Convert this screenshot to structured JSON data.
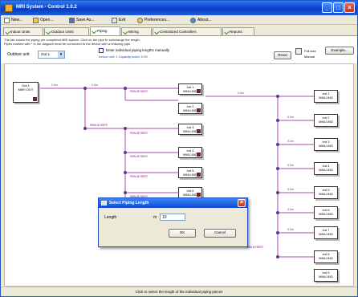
{
  "window": {
    "title": "MRI System - Control 1.0.2"
  },
  "menubar": {
    "items": [
      {
        "label": "New...",
        "icon": "new-file-icon"
      },
      {
        "label": "Open...",
        "icon": "open-folder-icon"
      },
      {
        "label": "Save As...",
        "icon": "save-icon"
      },
      {
        "label": "Exit",
        "icon": "exit-icon"
      },
      {
        "label": "Preferences...",
        "icon": "star-icon"
      },
      {
        "label": "About...",
        "icon": "info-icon"
      }
    ]
  },
  "tabs": [
    {
      "label": "Indoor Units",
      "active": false
    },
    {
      "label": "Outdoor Units",
      "active": false
    },
    {
      "label": "Piping",
      "active": true
    },
    {
      "label": "Wiring",
      "active": false
    },
    {
      "label": "Centralized Controllers",
      "active": false
    },
    {
      "label": "Reports",
      "active": false
    }
  ],
  "info": {
    "line1": "The tab shows the piping per completed MRI system. Click on the pipe to set/change the length.",
    "line2": "Pipes marked with * in the diagram must be connected to the device with a reducing pipe."
  },
  "controls": {
    "outdoor_unit_label": "Outdoor unit",
    "outdoor_unit_value": "Out 1",
    "checkbox_label": "Enter individual piping lengths manually",
    "checkbox_sub": "Indoor unit: 1 Capacity index: 0.00",
    "example_button": "Example...",
    "reset_button": "Reset",
    "view_full": "Full size",
    "view_manual": "Manual"
  },
  "diagram": {
    "outdoor": {
      "name": "Out 1",
      "model": "MMY-OUT"
    },
    "indoor_left": [
      {
        "name": "Ind 1",
        "model": "MMU-IND"
      },
      {
        "name": "Ind 2",
        "model": "MMU-IND"
      },
      {
        "name": "Ind 3",
        "model": "MMU-IND"
      },
      {
        "name": "Ind 4",
        "model": "MMU-IND"
      },
      {
        "name": "Ind 5",
        "model": "MMU-IND"
      },
      {
        "name": "Ind 6",
        "model": "MMU-IND"
      },
      {
        "name": "Ind 7",
        "model": "MMU-IND"
      }
    ],
    "indoor_right": [
      {
        "name": "Ind 1",
        "model": "MMU-IND"
      },
      {
        "name": "Ind 2",
        "model": "MMU-IND"
      },
      {
        "name": "Ind 3",
        "model": "MMU-IND"
      },
      {
        "name": "Ind 4",
        "model": "MMU-IND"
      },
      {
        "name": "Ind 5",
        "model": "MMU-IND"
      },
      {
        "name": "Ind 6",
        "model": "MMU-IND"
      },
      {
        "name": "Ind 7",
        "model": "MMU-IND"
      },
      {
        "name": "Ind 8",
        "model": "MMU-IND"
      },
      {
        "name": "Ind 9",
        "model": "MMU-IND"
      },
      {
        "name": "Ind 10",
        "model": "MMU-IND"
      }
    ],
    "pipe_label": "RBM-BY55FE",
    "pipe_length": "0.0m"
  },
  "dialog": {
    "title": "Select Piping Length",
    "length_label": "Length",
    "unit_label": "m",
    "length_value": "10",
    "ok_label": "OK",
    "cancel_label": "Cancel"
  },
  "status": {
    "text": "Click to select the length of the individual piping pieces"
  },
  "colors": {
    "pipe": "#b04ab0",
    "titlebar": "#0a3dbf",
    "unit_marker": "#7a1e1e"
  }
}
